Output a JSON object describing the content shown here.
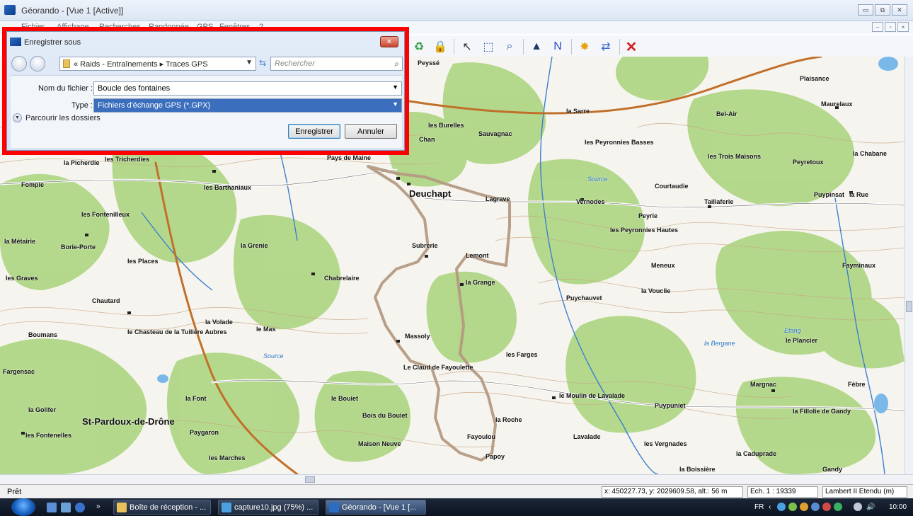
{
  "window": {
    "title": "Géorando - [Vue 1 [Active]]",
    "buttons": [
      "▭",
      "⧉",
      "✕"
    ],
    "mdi_buttons": [
      "–",
      "▫",
      "×"
    ]
  },
  "menu": {
    "items": [
      "Fichier",
      "Affichage",
      "Recherches",
      "Randonnée",
      "GPS",
      "Fenêtres",
      "?"
    ]
  },
  "toolbar": {
    "icons": [
      "recycle-icon",
      "lock-icon",
      "cursor-icon",
      "zoom-rect-icon",
      "zoom-out-icon",
      "profile-icon",
      "route-icon",
      "waypoint-icon",
      "gps-transfer-icon",
      "delete-icon"
    ]
  },
  "dialog": {
    "title": "Enregistrer sous",
    "close": "✕",
    "breadcrumb": "«  Raids - Entraînements  ▸  Traces GPS",
    "search_placeholder": "Rechercher",
    "filename_label": "Nom du fichier :",
    "filename_value": "Boucle des fontaines",
    "type_label": "Type :",
    "type_value": "Fichiers d'échange GPS (*.GPX)",
    "browse_label": "Parcourir les dossiers",
    "save_button": "Enregistrer",
    "cancel_button": "Annuler"
  },
  "map": {
    "labels": [
      {
        "text": "Deuchapt",
        "big": true
      },
      {
        "text": "Peyssé"
      },
      {
        "text": "les Tricherdies"
      },
      {
        "text": "Plaisance"
      },
      {
        "text": "Maurelaux"
      },
      {
        "text": "la Sarre"
      },
      {
        "text": "Bel-Air"
      },
      {
        "text": "les Burelles"
      },
      {
        "text": "Sauvagnac"
      },
      {
        "text": "les Peyronnies Basses"
      },
      {
        "text": "les Trois Maisons"
      },
      {
        "text": "Peyretoux"
      },
      {
        "text": "la Chabane"
      },
      {
        "text": "la Rue"
      },
      {
        "text": "Puypinsat"
      },
      {
        "text": "Courtaudie"
      },
      {
        "text": "Taillaferie"
      },
      {
        "text": "Vernodes"
      },
      {
        "text": "Peyrie"
      },
      {
        "text": "les Peyronnies Hautes"
      },
      {
        "text": "Meneux"
      },
      {
        "text": "Fayminaux"
      },
      {
        "text": "la Picherdie"
      },
      {
        "text": "Pays de Maine"
      },
      {
        "text": "Chan"
      },
      {
        "text": "les Barthaniaux"
      },
      {
        "text": "Fompie"
      },
      {
        "text": "les Fontenilleux"
      },
      {
        "text": "Lagrave"
      },
      {
        "text": "la Métairie"
      },
      {
        "text": "Borie-Porte"
      },
      {
        "text": "les Places"
      },
      {
        "text": "la Grenie"
      },
      {
        "text": "Subrerie"
      },
      {
        "text": "Lemont"
      },
      {
        "text": "la Grange"
      },
      {
        "text": "Chabrelaire"
      },
      {
        "text": "les Graves"
      },
      {
        "text": "Chautard"
      },
      {
        "text": "la Volade"
      },
      {
        "text": "le Mas"
      },
      {
        "text": "le Chasteau de la Tuilière Aubres"
      },
      {
        "text": "Massoly"
      },
      {
        "text": "Puychauvet"
      },
      {
        "text": "la Vouclie"
      },
      {
        "text": "le Plancier"
      },
      {
        "text": "Boumans"
      },
      {
        "text": "Fargensac"
      },
      {
        "text": "les Farges"
      },
      {
        "text": "Le Claud de Fayoulette"
      },
      {
        "text": "Margnac"
      },
      {
        "text": "Fèbre"
      },
      {
        "text": "le Bouiet"
      },
      {
        "text": "la Font"
      },
      {
        "text": "la Golifer"
      },
      {
        "text": "la Roche"
      },
      {
        "text": "le Moulin de Lavalade"
      },
      {
        "text": "Puypuniet"
      },
      {
        "text": "la Fillolie de Gandy"
      },
      {
        "text": "St-Pardoux-de-Drône",
        "big": true
      },
      {
        "text": "les Fontenelles"
      },
      {
        "text": "Paygaron"
      },
      {
        "text": "Bois du Bouiet"
      },
      {
        "text": "Maison Neuve"
      },
      {
        "text": "Fayoulou"
      },
      {
        "text": "Lavalade"
      },
      {
        "text": "les Vergnades"
      },
      {
        "text": "la Caduprade"
      },
      {
        "text": "les Marches"
      },
      {
        "text": "Papoy"
      },
      {
        "text": "la Boissière"
      },
      {
        "text": "Gandy"
      }
    ],
    "water_labels": [
      "Source",
      "la Bergane",
      "Etang",
      "Source"
    ]
  },
  "statusbar": {
    "left": "Prêt",
    "coords": "x: 450227.73, y: 2029609.58, alt.: 56 m",
    "scale": "Ech. 1 : 19339",
    "projection": "Lambert II Etendu (m)"
  },
  "taskbar": {
    "windows": [
      {
        "label": "Boîte de réception - ...",
        "active": false
      },
      {
        "label": "capture10.jpg (75%) ...",
        "active": false
      },
      {
        "label": "Géorando - [Vue 1 [...",
        "active": true
      }
    ],
    "tray": {
      "lang": "FR",
      "time": "10:00"
    }
  },
  "colors": {
    "highlight": "#ff0000",
    "track": "#b49a82",
    "forest": "#9ccd6a",
    "road_main": "#c0702a",
    "water": "#3a7fd0"
  }
}
